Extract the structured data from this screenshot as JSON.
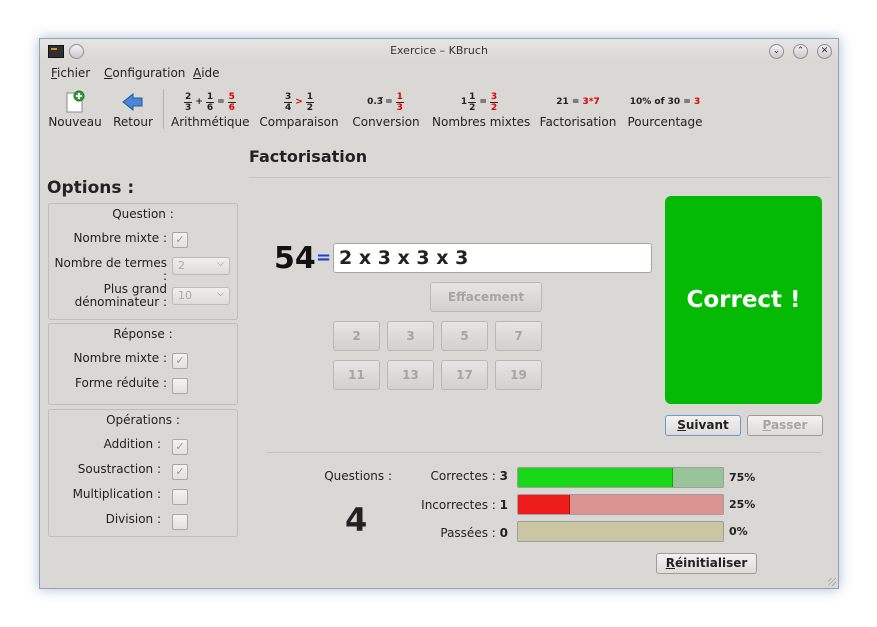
{
  "window": {
    "title": "Exercice – KBruch"
  },
  "menubar": [
    {
      "first": "F",
      "rest": "ichier"
    },
    {
      "first": "C",
      "rest": "onfiguration"
    },
    {
      "first": "A",
      "rest": "ide"
    }
  ],
  "toolbar": {
    "nouveau": "Nouveau",
    "retour": "Retour",
    "arithmetique": "Arithmétique",
    "arith_icon": {
      "n1": "2",
      "d1": "3",
      "op": "+",
      "n2": "1",
      "d2": "6",
      "eq": "=",
      "n3": "5",
      "d3": "6"
    },
    "comparaison": "Comparaison",
    "comp_icon": {
      "n1": "3",
      "d1": "4",
      "op": ">",
      "n2": "1",
      "d2": "2"
    },
    "conversion": "Conversion",
    "conv_icon": {
      "dec": "0.3̅",
      "eq": "=",
      "n": "1",
      "d": "3"
    },
    "nombres_mixtes": "Nombres mixtes",
    "mixed_icon": {
      "whole": "1",
      "n1": "1",
      "d1": "2",
      "eq": "=",
      "n2": "3",
      "d2": "2"
    },
    "factorisation": "Factorisation",
    "fact_icon": {
      "left": "21 =",
      "right": "3*7"
    },
    "pourcentage": "Pourcentage",
    "pct_icon": {
      "left": "10% of 30 =",
      "right": "3"
    }
  },
  "exercise": {
    "heading": "Factorisation"
  },
  "options": {
    "title": "Options :",
    "question": {
      "title": "Question :",
      "mixed_label": "Nombre mixte :",
      "terms_label": "Nombre de termes :",
      "terms_value": "2",
      "denom_label_1": "Plus grand",
      "denom_label_2": "dénominateur :",
      "denom_value": "10"
    },
    "reponse": {
      "title": "Réponse :",
      "mixed_label": "Nombre mixte :",
      "reduced_label": "Forme réduite :"
    },
    "operations": {
      "title": "Opérations :",
      "addition": "Addition :",
      "soustraction": "Soustraction :",
      "multiplication": "Multiplication :",
      "division": "Division :"
    }
  },
  "task": {
    "number": "54",
    "equals": "=",
    "answer": "2 x 3 x 3 x 3",
    "clear": "Effacement",
    "primes": [
      "2",
      "3",
      "5",
      "7",
      "11",
      "13",
      "17",
      "19"
    ]
  },
  "result": {
    "text": "Correct !",
    "color": "#05ba05"
  },
  "actions": {
    "next_first": "S",
    "next_rest": "uivant",
    "skip_first": "P",
    "skip_rest": "asser"
  },
  "stats": {
    "questions_label": "Questions :",
    "questions_value": "4",
    "correct_label": "Correctes :",
    "correct_value": "3",
    "correct_pct": "75%",
    "correct_fraction": 0.75,
    "incorrect_label": "Incorrectes :",
    "incorrect_value": "1",
    "incorrect_pct": "25%",
    "incorrect_fraction": 0.25,
    "skipped_label": "Passées :",
    "skipped_value": "0",
    "skipped_pct": "0%",
    "skipped_fraction": 0.0,
    "reset_first": "R",
    "reset_rest": "éinitialiser"
  },
  "colors": {
    "correct_bar": "#18d818",
    "incorrect_bar": "#ee1b1b",
    "accent_blue": "#1a3fd6"
  }
}
